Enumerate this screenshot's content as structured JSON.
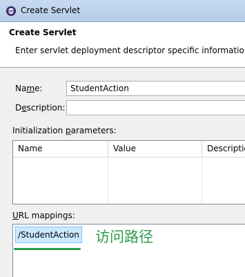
{
  "window": {
    "title": "Create Servlet"
  },
  "header": {
    "title": "Create Servlet",
    "description": "Enter servlet deployment descriptor specific information."
  },
  "form": {
    "name_label_pre": "Na",
    "name_label_mnemonic": "m",
    "name_label_post": "e:",
    "name_value": "StudentAction",
    "description_label_pre": "D",
    "description_label_mnemonic": "e",
    "description_label_post": "scription:",
    "description_value": ""
  },
  "init_params": {
    "label_pre": "Initialization ",
    "label_mnemonic": "p",
    "label_post": "arameters:",
    "columns": [
      "Name",
      "Value",
      "Description"
    ],
    "rows": []
  },
  "url_mappings": {
    "label_pre": "",
    "label_mnemonic": "U",
    "label_post": "RL mappings:",
    "items": [
      "/StudentAction"
    ]
  },
  "annotation": {
    "text": "访问路径",
    "color": "#2e9b4b"
  },
  "icons": {
    "app": "eclipse-icon"
  }
}
